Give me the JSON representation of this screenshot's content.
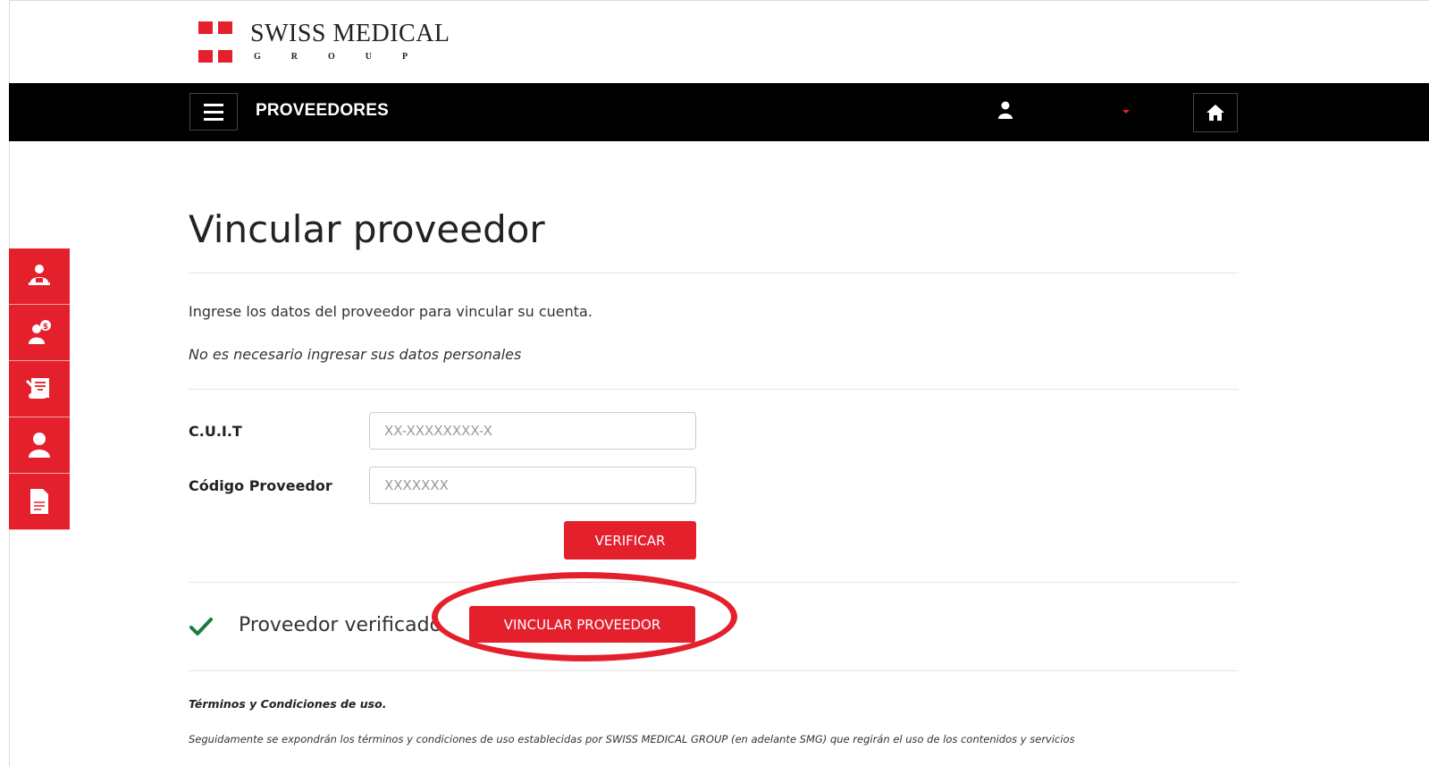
{
  "header": {
    "brand_name": "SWISS MEDICAL",
    "brand_sub": "GROUP"
  },
  "navbar": {
    "title": "PROVEEDORES",
    "icons": [
      "menu-icon",
      "user-icon",
      "caret-down-icon",
      "home-icon"
    ]
  },
  "sidebar": {
    "items": [
      {
        "icon": "person-desk-icon"
      },
      {
        "icon": "person-money-icon"
      },
      {
        "icon": "scroll-document-icon"
      },
      {
        "icon": "user-icon"
      },
      {
        "icon": "file-icon"
      }
    ]
  },
  "main": {
    "page_title": "Vincular proveedor",
    "intro": "Ingrese los datos del proveedor para vincular su cuenta.",
    "note": "No es necesario ingresar sus datos personales",
    "form": {
      "cuit_label": "C.U.I.T",
      "cuit_placeholder": "XX-XXXXXXXX-X",
      "codigo_label": "Código Proveedor",
      "codigo_placeholder": "XXXXXXX",
      "verify_button": "VERIFICAR"
    },
    "verification": {
      "status_text": "Proveedor verificado",
      "link_button": "VINCULAR PROVEEDOR"
    },
    "terms": {
      "title": "Términos y Condiciones de uso.",
      "text": "Seguidamente se expondrán los términos y condiciones de uso establecidas por SWISS MEDICAL GROUP (en adelante SMG) que regirán el uso de los contenidos y servicios"
    }
  },
  "colors": {
    "accent": "#e4202d",
    "navbar_bg": "#000000",
    "check_green": "#1f7a3f"
  }
}
